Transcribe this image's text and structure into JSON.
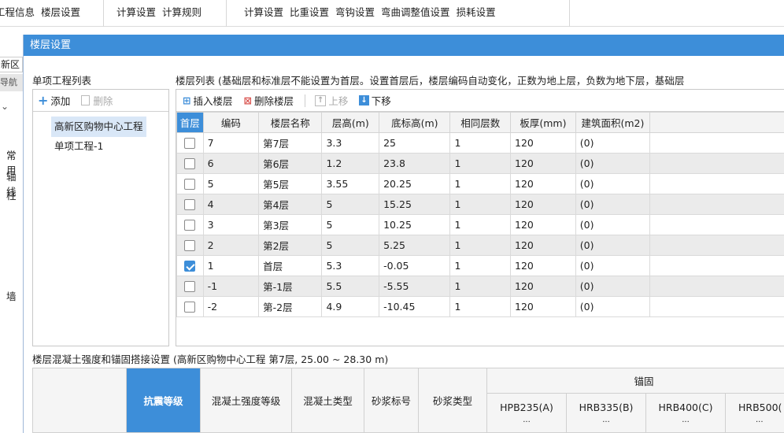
{
  "ribbon": {
    "groups": [
      {
        "items": [
          "工程信息",
          "楼层设置"
        ]
      },
      {
        "items": [
          "计算设置",
          "计算规则"
        ]
      },
      {
        "items": [
          "计算设置",
          "比重设置",
          "弯钩设置",
          "弯曲调整值设置",
          "损耗设置"
        ]
      }
    ]
  },
  "left_strip": {
    "items": [
      "新区",
      "导航栏",
      "常用",
      "轴线",
      "柱",
      "墙"
    ]
  },
  "dialog": {
    "title": "楼层设置",
    "project_list_label": "单项工程列表",
    "floor_list_label": "楼层列表 (基础层和标准层不能设置为首层。设置首层后，楼层编码自动变化，正数为地上层，负数为地下层，基础层",
    "left_toolbar": {
      "add": "添加",
      "delete": "删除"
    },
    "projects": [
      "高新区购物中心工程",
      "单项工程-1"
    ],
    "right_toolbar": {
      "insert": "插入楼层",
      "delete": "删除楼层",
      "up": "上移",
      "down": "下移"
    },
    "columns": [
      "首层",
      "编码",
      "楼层名称",
      "层高(m)",
      "底标高(m)",
      "相同层数",
      "板厚(mm)",
      "建筑面积(m2)"
    ],
    "rows": [
      {
        "checked": false,
        "code": "7",
        "name": "第7层",
        "height": "3.3",
        "base": "25",
        "same": "1",
        "thick": "120",
        "area": "(0)"
      },
      {
        "checked": false,
        "code": "6",
        "name": "第6层",
        "height": "1.2",
        "base": "23.8",
        "same": "1",
        "thick": "120",
        "area": "(0)"
      },
      {
        "checked": false,
        "code": "5",
        "name": "第5层",
        "height": "3.55",
        "base": "20.25",
        "same": "1",
        "thick": "120",
        "area": "(0)"
      },
      {
        "checked": false,
        "code": "4",
        "name": "第4层",
        "height": "5",
        "base": "15.25",
        "same": "1",
        "thick": "120",
        "area": "(0)"
      },
      {
        "checked": false,
        "code": "3",
        "name": "第3层",
        "height": "5",
        "base": "10.25",
        "same": "1",
        "thick": "120",
        "area": "(0)"
      },
      {
        "checked": false,
        "code": "2",
        "name": "第2层",
        "height": "5",
        "base": "5.25",
        "same": "1",
        "thick": "120",
        "area": "(0)"
      },
      {
        "checked": true,
        "code": "1",
        "name": "首层",
        "height": "5.3",
        "base": "-0.05",
        "same": "1",
        "thick": "120",
        "area": "(0)"
      },
      {
        "checked": false,
        "code": "-1",
        "name": "第-1层",
        "height": "5.5",
        "base": "-5.55",
        "same": "1",
        "thick": "120",
        "area": "(0)"
      },
      {
        "checked": false,
        "code": "-2",
        "name": "第-2层",
        "height": "4.9",
        "base": "-10.45",
        "same": "1",
        "thick": "120",
        "area": "(0)"
      }
    ],
    "concrete_label": "楼层混凝土强度和锚固搭接设置 (高新区购物中心工程 第7层, 25.00 ~ 28.30 m)",
    "bottom_headers": {
      "seismic": "抗震等级",
      "concrete_grade": "混凝土强度等级",
      "concrete_type": "混凝土类型",
      "mortar_grade": "砂浆标号",
      "mortar_type": "砂浆类型",
      "anchor": "锚固",
      "bars": [
        "HPB235(A)",
        "HRB335(B)",
        "HRB400(C)",
        "HRB500("
      ],
      "ellipsis": "..."
    }
  },
  "colors": {
    "accent": "#3d8ed9",
    "title_bar": "#3d8ed9"
  }
}
